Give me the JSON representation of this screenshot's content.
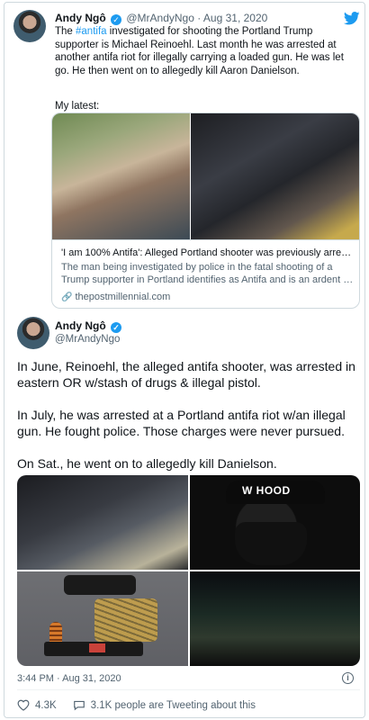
{
  "quoted_tweet": {
    "name": "Andy Ngô",
    "handle": "@MrAndyNgo",
    "separator": "·",
    "date": "Aug 31, 2020",
    "text_before": "The ",
    "hashtag": "#antifa",
    "text_after": " investigated for shooting the Portland Trump supporter is Michael Reinoehl. Last month he was arrested at another antifa riot for illegally carrying a loaded gun. He was let go. He then went on to allegedly kill Aaron Danielson.",
    "latest": "My latest:",
    "link_card": {
      "title": "'I am 100% Antifa': Alleged Portland shooter was previously arres…",
      "description": "The man being investigated by police in the fatal shooting of a Trump supporter in Portland identifies as Antifa and is an ardent …",
      "domain": "thepostmillennial.com"
    }
  },
  "main_tweet": {
    "name": "Andy Ngô",
    "handle": "@MrAndyNgo",
    "paragraphs": [
      "In June, Reinoehl, the alleged antifa shooter, was arrested in eastern OR w/stash of drugs & illegal pistol.",
      "In July, he was arrested at a Portland antifa riot w/an illegal gun. He fought police. Those charges were never pursued.",
      "On Sat., he went on to allegedly kill Danielson."
    ],
    "media_text": "W HOOD",
    "time": "3:44 PM",
    "date": "Aug 31, 2020",
    "separator": "·",
    "likes": "4.3K",
    "tweeting": "3.1K people are Tweeting about this"
  },
  "icons": {
    "verified": "verified-badge-icon",
    "bird": "twitter-bird-icon",
    "link": "link-icon",
    "heart": "heart-icon",
    "comment": "comment-icon",
    "info": "info-icon"
  },
  "colors": {
    "accent": "#1d9bf0",
    "text": "#0f1419",
    "muted": "#536471"
  }
}
